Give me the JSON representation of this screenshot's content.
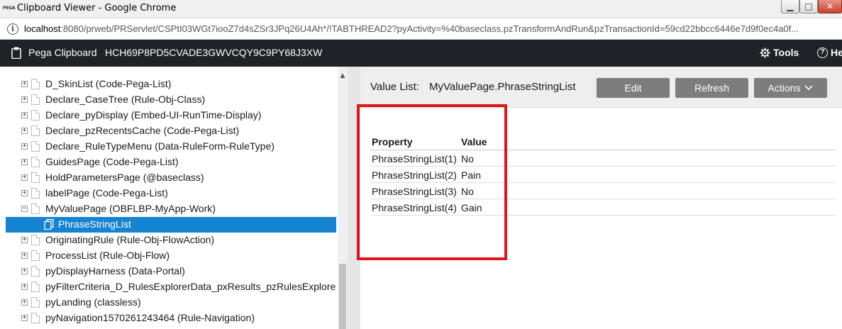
{
  "window": {
    "logo_text": "PEGA",
    "title": "Clipboard Viewer - Google Chrome",
    "minimize": "▁",
    "maximize": "□",
    "close": "✕"
  },
  "address_bar": {
    "host": "localhost",
    "path": ":8080/prweb/PRServlet/CSPtI03WGt7iooZ7d4sZSr3JPq26U4Ah*/!TABTHREAD2?pyActivity=%40baseclass.pzTransformAndRun&pzTransactionId=59cd22bbcc6446e7d9f0ec4a0f..."
  },
  "pega_header": {
    "title": "Pega Clipboard",
    "thread_id": "HCH69P8PD5CVADE3GWVCQY9C9PY68J3XW",
    "tools_label": "Tools",
    "help_label": "He"
  },
  "tree": {
    "items": [
      {
        "label": "D_SkinList (Code-Pega-List)",
        "expander": "+"
      },
      {
        "label": "Declare_CaseTree (Rule-Obj-Class)",
        "expander": "+"
      },
      {
        "label": "Declare_pyDisplay (Embed-UI-RunTime-Display)",
        "expander": "+"
      },
      {
        "label": "Declare_pzRecentsCache (Code-Pega-List)",
        "expander": "+"
      },
      {
        "label": "Declare_RuleTypeMenu (Data-RuleForm-RuleType)",
        "expander": "+"
      },
      {
        "label": "GuidesPage (Code-Pega-List)",
        "expander": "+"
      },
      {
        "label": "HoldParametersPage (@baseclass)",
        "expander": "+"
      },
      {
        "label": "labelPage (Code-Pega-List)",
        "expander": "+"
      },
      {
        "label": "MyValuePage (OBFLBP-MyApp-Work)",
        "expander": "−"
      },
      {
        "label": "PhraseStringList",
        "expander": ""
      },
      {
        "label": "OriginatingRule (Rule-Obj-FlowAction)",
        "expander": "+"
      },
      {
        "label": "ProcessList (Rule-Obj-Flow)",
        "expander": "+"
      },
      {
        "label": "pyDisplayHarness (Data-Portal)",
        "expander": "+"
      },
      {
        "label": "pyFilterCriteria_D_RulesExplorerData_pxResults_pzRulesExplore",
        "expander": "+"
      },
      {
        "label": "pyLanding (classless)",
        "expander": "+"
      },
      {
        "label": "pyNavigation1570261243464 (Rule-Navigation)",
        "expander": "+"
      }
    ]
  },
  "value_list": {
    "title": "Value List:",
    "page_name": "MyValuePage.PhraseStringList",
    "buttons": {
      "edit": "Edit",
      "refresh": "Refresh",
      "actions": "Actions"
    },
    "columns": {
      "property": "Property",
      "value": "Value"
    },
    "rows": [
      {
        "property": "PhraseStringList(1)",
        "value": "No"
      },
      {
        "property": "PhraseStringList(2)",
        "value": "Pain"
      },
      {
        "property": "PhraseStringList(3)",
        "value": "No"
      },
      {
        "property": "PhraseStringList(4)",
        "value": "Gain"
      }
    ]
  },
  "colors": {
    "header_bg": "#1f2226",
    "selected_row": "#1683d0",
    "button_bg": "#7d7d7d",
    "highlight_border": "#e0141a"
  }
}
